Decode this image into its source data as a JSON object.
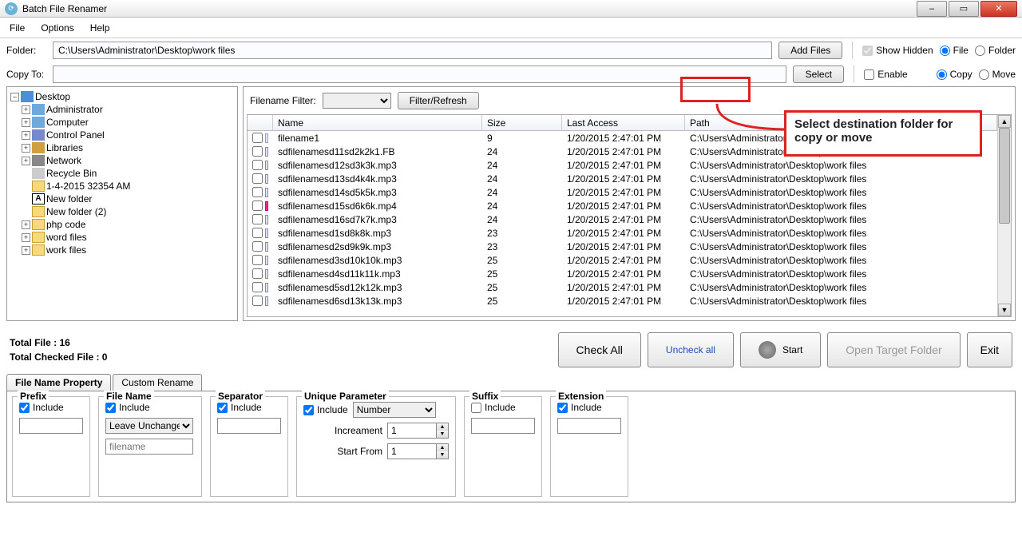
{
  "window": {
    "title": "Batch File Renamer",
    "min_icon": "–",
    "max_icon": "▭",
    "close_icon": "✕"
  },
  "menu": {
    "file": "File",
    "options": "Options",
    "help": "Help"
  },
  "folder_row": {
    "label": "Folder:",
    "path": "C:\\Users\\Administrator\\Desktop\\work files",
    "add_files": "Add Files",
    "show_hidden": "Show Hidden",
    "file": "File",
    "folder": "Folder"
  },
  "copy_row": {
    "label": "Copy To:",
    "path": "",
    "select": "Select",
    "enable": "Enable",
    "copy": "Copy",
    "move": "Move"
  },
  "tree": {
    "root": "Desktop",
    "items": [
      {
        "exp": "+",
        "icon": "monitor",
        "label": "Administrator"
      },
      {
        "exp": "+",
        "icon": "monitor",
        "label": "Computer"
      },
      {
        "exp": "+",
        "icon": "panel",
        "label": "Control Panel"
      },
      {
        "exp": "+",
        "icon": "lib",
        "label": "Libraries"
      },
      {
        "exp": "+",
        "icon": "net",
        "label": "Network"
      },
      {
        "exp": "",
        "icon": "bin",
        "label": "Recycle Bin"
      },
      {
        "exp": "",
        "icon": "folder",
        "label": "1-4-2015 32354 AM"
      },
      {
        "exp": "",
        "icon": "a",
        "label": "New folder"
      },
      {
        "exp": "",
        "icon": "folder",
        "label": "New folder (2)"
      },
      {
        "exp": "+",
        "icon": "folder",
        "label": "php code"
      },
      {
        "exp": "+",
        "icon": "folder",
        "label": "word files"
      },
      {
        "exp": "+",
        "icon": "folder",
        "label": "work files"
      }
    ]
  },
  "filter": {
    "label": "Filename Filter:",
    "btn": "Filter/Refresh"
  },
  "cols": {
    "name": "Name",
    "size": "Size",
    "access": "Last Access",
    "path": "Path"
  },
  "rows": [
    {
      "ico": "",
      "name": "filename1",
      "size": "9",
      "access": "1/20/2015 2:47:01 PM",
      "path": "C:\\Users\\Administrator\\Desktop\\work files"
    },
    {
      "ico": "mp3",
      "name": "sdfilenamesd11sd2k2k1.FB",
      "size": "24",
      "access": "1/20/2015 2:47:01 PM",
      "path": "C:\\Users\\Administrator\\Desktop\\work files"
    },
    {
      "ico": "mp3",
      "name": "sdfilenamesd12sd3k3k.mp3",
      "size": "24",
      "access": "1/20/2015 2:47:01 PM",
      "path": "C:\\Users\\Administrator\\Desktop\\work files"
    },
    {
      "ico": "mp3",
      "name": "sdfilenamesd13sd4k4k.mp3",
      "size": "24",
      "access": "1/20/2015 2:47:01 PM",
      "path": "C:\\Users\\Administrator\\Desktop\\work files"
    },
    {
      "ico": "mp3",
      "name": "sdfilenamesd14sd5k5k.mp3",
      "size": "24",
      "access": "1/20/2015 2:47:01 PM",
      "path": "C:\\Users\\Administrator\\Desktop\\work files"
    },
    {
      "ico": "mp4",
      "name": "sdfilenamesd15sd6k6k.mp4",
      "size": "24",
      "access": "1/20/2015 2:47:01 PM",
      "path": "C:\\Users\\Administrator\\Desktop\\work files"
    },
    {
      "ico": "mp3",
      "name": "sdfilenamesd16sd7k7k.mp3",
      "size": "24",
      "access": "1/20/2015 2:47:01 PM",
      "path": "C:\\Users\\Administrator\\Desktop\\work files"
    },
    {
      "ico": "mp3",
      "name": "sdfilenamesd1sd8k8k.mp3",
      "size": "23",
      "access": "1/20/2015 2:47:01 PM",
      "path": "C:\\Users\\Administrator\\Desktop\\work files"
    },
    {
      "ico": "mp3",
      "name": "sdfilenamesd2sd9k9k.mp3",
      "size": "23",
      "access": "1/20/2015 2:47:01 PM",
      "path": "C:\\Users\\Administrator\\Desktop\\work files"
    },
    {
      "ico": "mp3",
      "name": "sdfilenamesd3sd10k10k.mp3",
      "size": "25",
      "access": "1/20/2015 2:47:01 PM",
      "path": "C:\\Users\\Administrator\\Desktop\\work files"
    },
    {
      "ico": "mp3",
      "name": "sdfilenamesd4sd11k11k.mp3",
      "size": "25",
      "access": "1/20/2015 2:47:01 PM",
      "path": "C:\\Users\\Administrator\\Desktop\\work files"
    },
    {
      "ico": "mp3",
      "name": "sdfilenamesd5sd12k12k.mp3",
      "size": "25",
      "access": "1/20/2015 2:47:01 PM",
      "path": "C:\\Users\\Administrator\\Desktop\\work files"
    },
    {
      "ico": "mp3",
      "name": "sdfilenamesd6sd13k13k.mp3",
      "size": "25",
      "access": "1/20/2015 2:47:01 PM",
      "path": "C:\\Users\\Administrator\\Desktop\\work files"
    }
  ],
  "stats": {
    "total": "Total File :  16",
    "checked": "Total Checked File :  0"
  },
  "actions": {
    "check": "Check All",
    "uncheck": "Uncheck all",
    "start": "Start",
    "open": "Open Target Folder",
    "exit": "Exit"
  },
  "tabs": {
    "t1": "File Name Property",
    "t2": "Custom Rename"
  },
  "groups": {
    "prefix": {
      "legend": "Prefix",
      "include": "Include"
    },
    "filename": {
      "legend": "File Name",
      "include": "Include",
      "leave": "Leave Unchange",
      "placeholder": "filename"
    },
    "separator": {
      "legend": "Separator",
      "include": "Include"
    },
    "unique": {
      "legend": "Unique Parameter",
      "include": "Include",
      "number": "Number",
      "increment": "Increament",
      "increment_val": "1",
      "start": "Start From",
      "start_val": "1"
    },
    "suffix": {
      "legend": "Suffix",
      "include": "Include"
    },
    "extension": {
      "legend": "Extension",
      "include": "Include"
    }
  },
  "annotation": "Select destination folder for copy or move"
}
